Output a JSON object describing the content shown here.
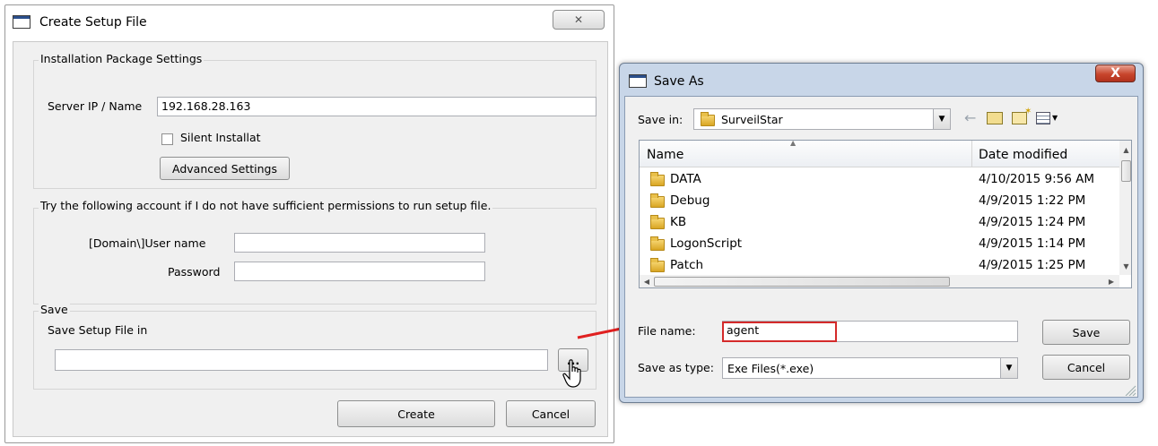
{
  "create_dialog": {
    "title": "Create Setup File",
    "close_glyph": "✕",
    "install_group": {
      "legend": "Installation Package Settings",
      "server_label": "Server IP / Name",
      "server_value": "192.168.28.163",
      "silent_label": "Silent Installat",
      "silent_checked": false,
      "advanced_button": "Advanced Settings"
    },
    "account_group": {
      "legend": "Try the following account if I do not have sufficient permissions to run setup file.",
      "username_label": "[Domain\\]User name",
      "username_value": "",
      "password_label": "Password",
      "password_value": ""
    },
    "save_group": {
      "legend": "Save",
      "save_in_label": "Save Setup File in",
      "path_value": "",
      "browse_button": "..."
    },
    "create_button": "Create",
    "cancel_button": "Cancel"
  },
  "save_as_dialog": {
    "title": "Save As",
    "close_glyph": "X",
    "save_in_label": "Save in:",
    "save_in_value": "SurveilStar",
    "columns": {
      "name": "Name",
      "date": "Date modified"
    },
    "files": [
      {
        "name": "DATA",
        "date": "4/10/2015 9:56 AM"
      },
      {
        "name": "Debug",
        "date": "4/9/2015 1:22 PM"
      },
      {
        "name": "KB",
        "date": "4/9/2015 1:24 PM"
      },
      {
        "name": "LogonScript",
        "date": "4/9/2015 1:14 PM"
      },
      {
        "name": "Patch",
        "date": "4/9/2015 1:25 PM"
      }
    ],
    "file_name_label": "File name:",
    "file_name_value": "agent",
    "save_as_type_label": "Save as type:",
    "save_as_type_value": "Exe Files(*.exe)",
    "save_button": "Save",
    "cancel_button": "Cancel"
  },
  "colors": {
    "highlight": "#d42a2a",
    "arrow": "#e02020",
    "folder": "#e8b83a"
  }
}
